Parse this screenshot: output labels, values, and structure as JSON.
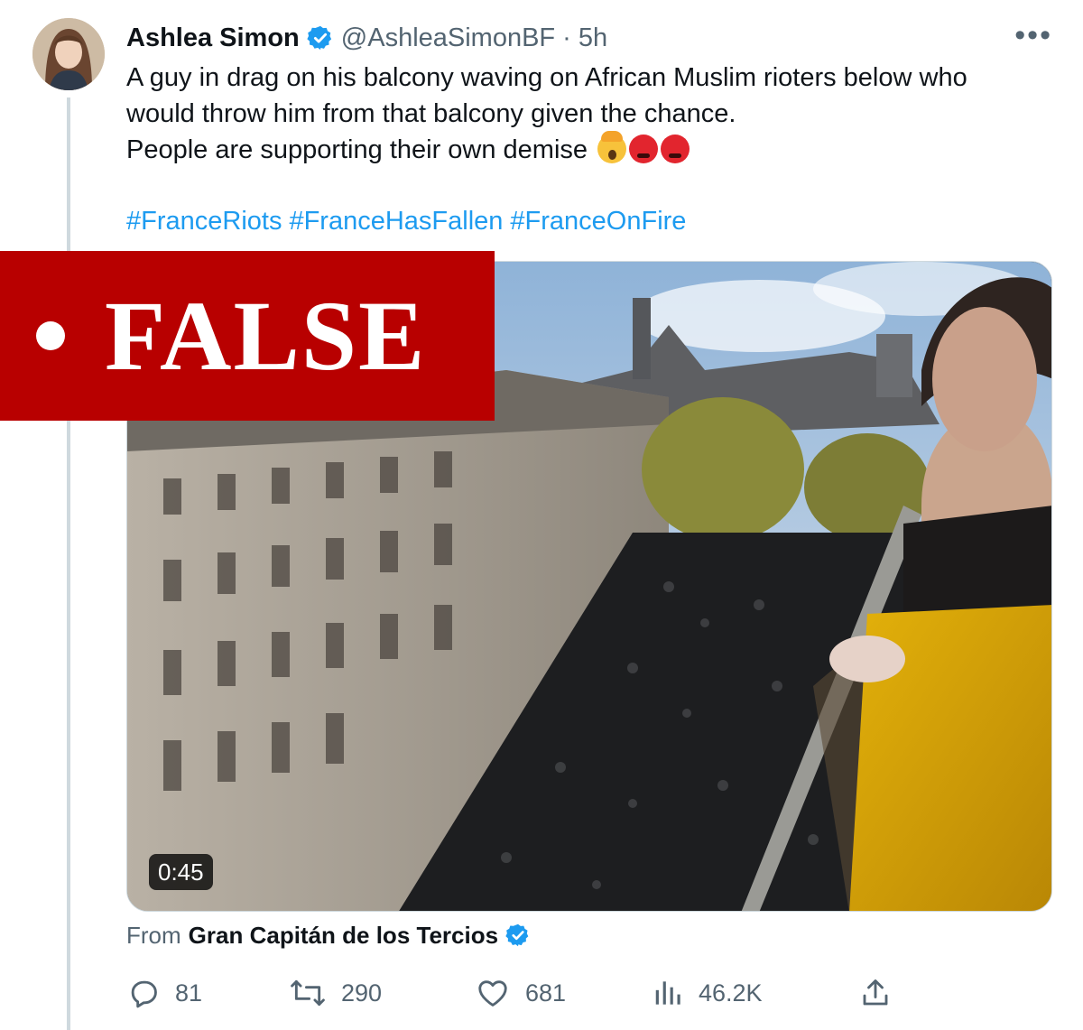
{
  "tweet": {
    "author": {
      "name": "Ashlea Simon",
      "handle": "@AshleaSimonBF",
      "separator": "·",
      "time": "5h"
    },
    "more_label": "•••",
    "text_lines": [
      "A guy in drag on his balcony waving on African Muslim rioters below who",
      "would throw him from that balcony given the chance.",
      "People are supporting their own demise"
    ],
    "emojis": [
      "exploding-head-emoji",
      "angry-face-emoji",
      "angry-face-emoji"
    ],
    "hashtags": [
      "#FranceRiots",
      "#FranceHasFallen",
      "#FranceOnFire"
    ],
    "media": {
      "type": "video",
      "duration": "0:45"
    },
    "from": {
      "prefix": "From",
      "name": "Gran Capitán de los Tercios"
    },
    "stats": {
      "replies": "81",
      "retweets": "290",
      "likes": "681",
      "views": "46.2K"
    }
  },
  "overlay": {
    "label": "FALSE"
  },
  "colors": {
    "accent": "#1d9bf0",
    "secondary_text": "#536471",
    "stamp_red": "#b80000"
  }
}
